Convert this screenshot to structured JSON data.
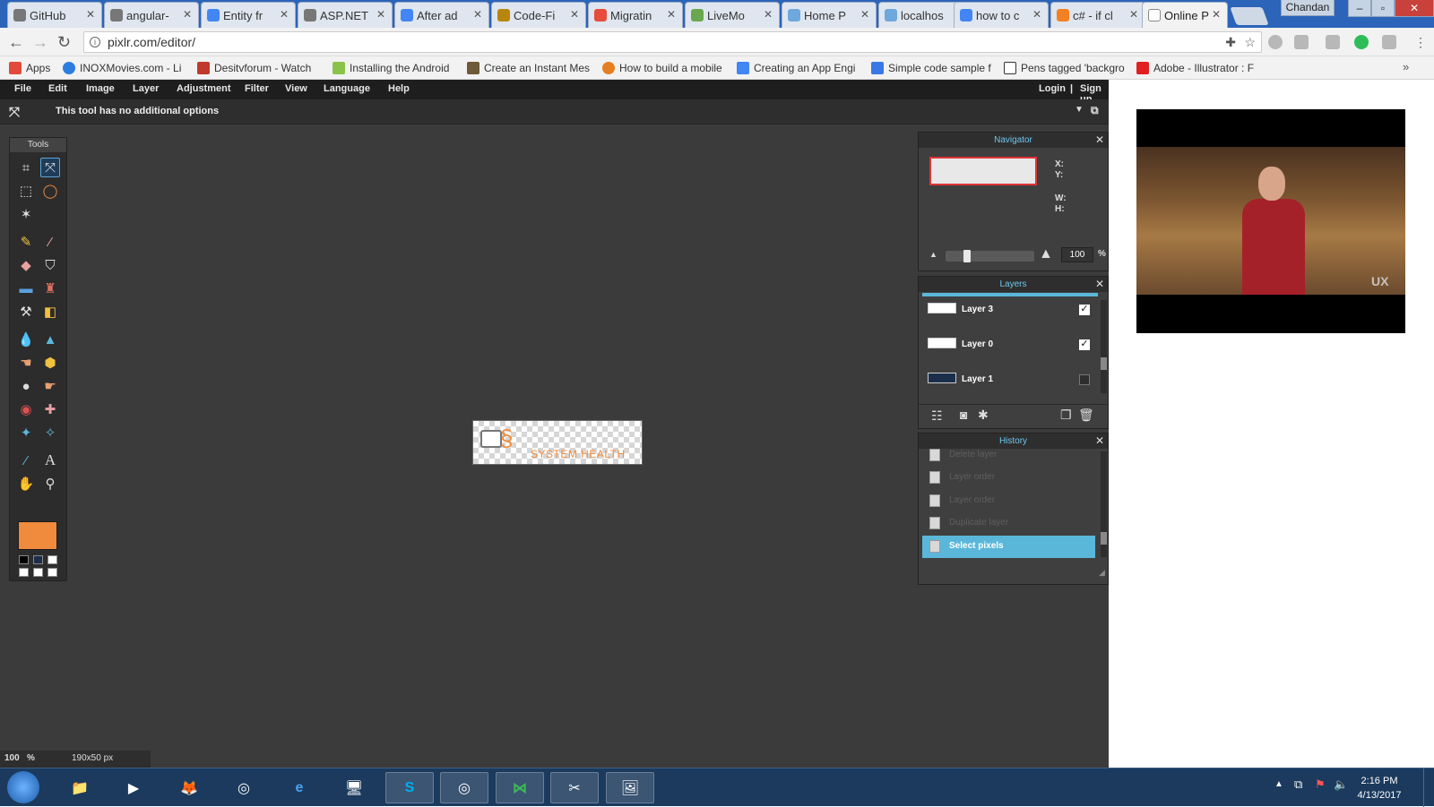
{
  "browser": {
    "tabs": [
      {
        "label": "GitHub",
        "fav": "#333333",
        "active": false
      },
      {
        "label": "angular-",
        "fav": "#333333",
        "active": false
      },
      {
        "label": "Entity fr",
        "fav": "#4285f4",
        "active": false
      },
      {
        "label": "ASP.NET",
        "fav": "#444444",
        "active": false
      },
      {
        "label": "After ad",
        "fav": "#4285f4",
        "active": false
      },
      {
        "label": "Code-Fi",
        "fav": "#b8860b",
        "active": false
      },
      {
        "label": "Migratin",
        "fav": "#e74c3c",
        "active": false
      },
      {
        "label": "LiveMo",
        "fav": "#6aa84f",
        "active": false
      },
      {
        "label": "Home P",
        "fav": "#6fa8dc",
        "active": false
      },
      {
        "label": "localhos",
        "fav": "#6fa8dc",
        "active": false
      },
      {
        "label": "how to c",
        "fav": "#4285f4",
        "active": false
      },
      {
        "label": "c# - if cl",
        "fav": "#f48024",
        "active": false
      },
      {
        "label": "Online P",
        "fav": "#888888",
        "active": true
      }
    ],
    "user": "Chandan",
    "url": "pixlr.com/editor/",
    "bookmarks": [
      {
        "label": "Apps",
        "color": "#e24a3b"
      },
      {
        "label": "INOXMovies.com - Li",
        "color": "#2b7de0"
      },
      {
        "label": "Desitvforum - Watch",
        "color": "#c0392b"
      },
      {
        "label": "Installing the Android",
        "color": "#8bc34a"
      },
      {
        "label": "Create an Instant Mes",
        "color": "#6d5a3a"
      },
      {
        "label": "How to build a mobile",
        "color": "#e67e22"
      },
      {
        "label": "Creating an App Engi",
        "color": "#4285f4"
      },
      {
        "label": "Simple code sample f",
        "color": "#3b78e7"
      },
      {
        "label": "Pens tagged 'backgro",
        "color": "#333333"
      },
      {
        "label": "Adobe - Illustrator : F",
        "color": "#e02020"
      }
    ]
  },
  "app": {
    "menu": [
      "File",
      "Edit",
      "Image",
      "Layer",
      "Adjustment",
      "Filter",
      "View",
      "Language",
      "Help"
    ],
    "login": "Login",
    "separator": "|",
    "signup": "Sign up",
    "options_text": "This tool has no additional options",
    "tools_title": "Tools",
    "primary_color": "#f08a3c",
    "canvas_logo_text": "SYSTEM HEALTH",
    "status_zoom": "100",
    "status_percent": "%",
    "status_size": "190x50 px"
  },
  "navigator": {
    "title": "Navigator",
    "x_label": "X:",
    "y_label": "Y:",
    "w_label": "W:",
    "h_label": "H:",
    "zoom_value": "100",
    "zoom_unit": "%",
    "zoom_fraction": 0.22
  },
  "layers": {
    "title": "Layers",
    "items": [
      {
        "name": "Layer 3",
        "visible": true
      },
      {
        "name": "Layer 0",
        "visible": true
      },
      {
        "name": "Layer 1",
        "visible": false
      }
    ]
  },
  "history": {
    "title": "History",
    "items": [
      {
        "label": "Delete layer",
        "active": false
      },
      {
        "label": "Layer order",
        "active": false
      },
      {
        "label": "Layer order",
        "active": false
      },
      {
        "label": "Duplicate layer",
        "active": false
      },
      {
        "label": "Select pixels",
        "active": true
      }
    ]
  },
  "taskbar": {
    "time": "2:16 PM",
    "date": "4/13/2017"
  },
  "video": {
    "watermark": "UX"
  }
}
